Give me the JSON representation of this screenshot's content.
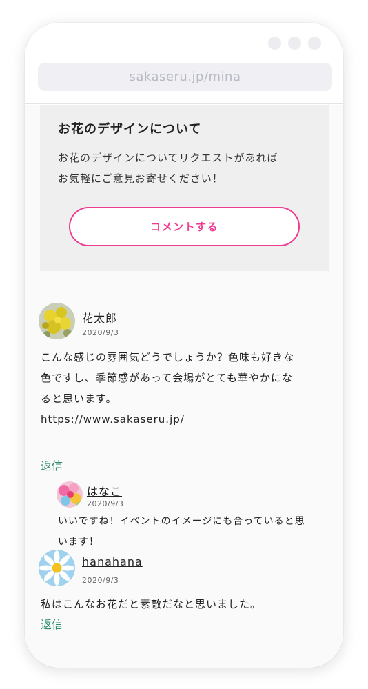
{
  "browser": {
    "url": "sakaseru.jp/mina"
  },
  "request": {
    "title": "お花のデザインについて",
    "line1": "お花のデザインについてリクエストがあれば",
    "line2": "お気軽にご意見お寄せください！",
    "button_label": "コメントする"
  },
  "comments": [
    {
      "username": "花太郎",
      "date": "2020/9/3",
      "line1": "こんな感じの雰囲気どうでしょうか？色味も好きな",
      "line2": "色ですし、季節感があって会場がとても華やかにな",
      "line3": "ると思います。",
      "link": "https://www.sakaseru.jp/",
      "reply_label": "返信",
      "reply": {
        "username": "はなこ",
        "date": "2020/9/3",
        "line1": "いいですね！イベントのイメージにも合っていると思",
        "line2": "います！"
      }
    },
    {
      "username": "hanahana",
      "date": "2020/9/3",
      "line1": "私はこんなお花だと素敵だなと思いました。",
      "reply_label": "返信"
    }
  ],
  "colors": {
    "accent": "#ee3a8f",
    "reply": "#2a8a6e",
    "request_bg": "#efefef"
  }
}
